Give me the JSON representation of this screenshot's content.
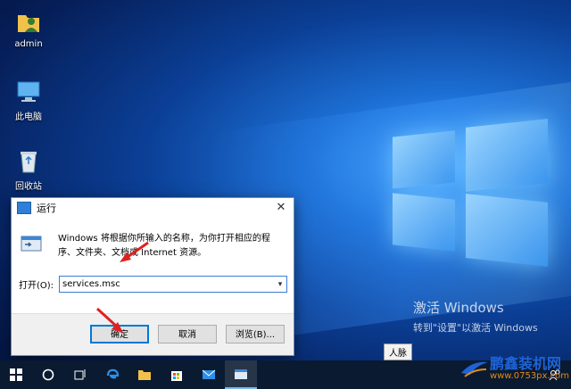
{
  "desktop": {
    "icons": [
      {
        "label": "admin",
        "icon": "user-folder-icon"
      },
      {
        "label": "此电脑",
        "icon": "computer-icon"
      },
      {
        "label": "回收站",
        "icon": "recycle-bin-icon"
      }
    ],
    "activation": {
      "title": "激活 Windows",
      "subtitle": "转到\"设置\"以激活 Windows"
    },
    "tooltip": "人脉"
  },
  "run_dialog": {
    "title": "运行",
    "description": "Windows 将根据你所输入的名称，为你打开相应的程序、文件夹、文档或 Internet 资源。",
    "open_label": "打开(O):",
    "input_value": "services.msc",
    "ok_label": "确定",
    "cancel_label": "取消",
    "browse_label": "浏览(B)..."
  },
  "taskbar": {
    "items": [
      "windows-start-icon",
      "cortana-icon",
      "task-view-icon",
      "edge-icon",
      "file-explorer-icon",
      "store-icon",
      "mail-icon",
      "run-app-icon"
    ]
  },
  "watermark": {
    "text": "鹏鑫装机网",
    "url": "www.0753px.com"
  },
  "colors": {
    "accent": "#0078d7",
    "arrow": "#e02020"
  }
}
